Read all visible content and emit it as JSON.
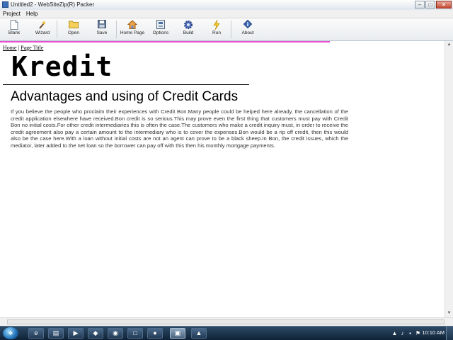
{
  "window": {
    "title": "Untitled2 - WebSiteZip(R) Packer"
  },
  "menu": {
    "items": [
      "Project",
      "Help"
    ]
  },
  "toolbar": {
    "buttons": [
      {
        "label": "Blank",
        "icon": "blank-page-icon"
      },
      {
        "label": "Wizard",
        "icon": "wand-icon"
      },
      {
        "label": "Open",
        "icon": "folder-icon"
      },
      {
        "label": "Save",
        "icon": "floppy-icon"
      },
      {
        "label": "Home Page",
        "icon": "home-icon"
      },
      {
        "label": "Options",
        "icon": "options-icon"
      },
      {
        "label": "Build",
        "icon": "gear-icon"
      },
      {
        "label": "Run",
        "icon": "lightning-icon"
      },
      {
        "label": "About",
        "icon": "info-icon"
      }
    ]
  },
  "page": {
    "breadcrumb": {
      "home": "Home",
      "separator": "|",
      "current": "Page Title"
    },
    "logo": "Kredit",
    "heading": "Advantages and using of Credit Cards",
    "paragraph": "If you believe the people who proclaim their experiences with Credit Bon.Many people could be helped here already, the cancellation of the credit application elsewhere have received.Bon credit is so serious.This may prove even the first thing that customers must pay with Credit Bon no initial costs.For other credit intermediaries this is often the case.The customers who make a credit inquiry must, in order to receive the credit agreement also pay a certain amount to the intermediary who is to cover the expenses.Bon would be a rip off credit, then this would also be the case here.With a loan without initial costs are not an agent can prove to be a black sheep.In Bon, the credit issues, which the mediator, later added to the net loan so the borrower can pay off with this then his monthly mortgage payments."
  },
  "taskbar": {
    "clock": "10:10 AM"
  },
  "colors": {
    "accent_line": "#e64fd6",
    "taskbar": "#1b324a"
  }
}
